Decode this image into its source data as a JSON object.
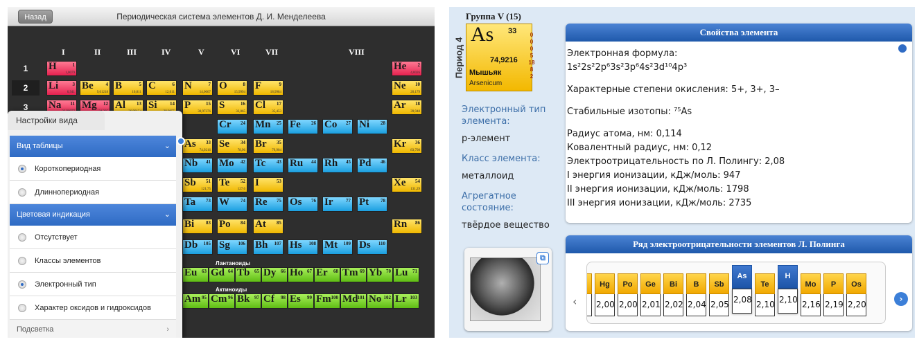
{
  "left_screen": {
    "back_label": "Назад",
    "title": "Периодическая система элементов Д. И. Менделеева",
    "groups": [
      "I",
      "II",
      "III",
      "IV",
      "V",
      "VI",
      "VII",
      "VIII"
    ],
    "periods": [
      "1",
      "2",
      "3"
    ],
    "elements": [
      {
        "sym": "H",
        "num": "1",
        "mass": "1,0079",
        "color": "red"
      },
      {
        "sym": "He",
        "num": "2",
        "mass": "4,0026",
        "color": "red"
      },
      {
        "sym": "Li",
        "num": "3",
        "mass": "6,941",
        "color": "red"
      },
      {
        "sym": "Be",
        "num": "4",
        "mass": "9,01218",
        "color": "yellow"
      },
      {
        "sym": "B",
        "num": "5",
        "mass": "10,811",
        "color": "yellow"
      },
      {
        "sym": "C",
        "num": "6",
        "mass": "12,011",
        "color": "yellow"
      },
      {
        "sym": "N",
        "num": "7",
        "mass": "14,0067",
        "color": "yellow"
      },
      {
        "sym": "O",
        "num": "8",
        "mass": "15,9994",
        "color": "yellow"
      },
      {
        "sym": "F",
        "num": "9",
        "mass": "18,9984",
        "color": "yellow"
      },
      {
        "sym": "Ne",
        "num": "10",
        "mass": "20,179",
        "color": "yellow"
      },
      {
        "sym": "Na",
        "num": "11",
        "mass": "22,98977",
        "color": "red"
      },
      {
        "sym": "Mg",
        "num": "12",
        "mass": "24,305",
        "color": "red"
      },
      {
        "sym": "Al",
        "num": "13",
        "mass": "26,98154",
        "color": "yellow"
      },
      {
        "sym": "Si",
        "num": "14",
        "mass": "28,0855",
        "color": "yellow"
      },
      {
        "sym": "P",
        "num": "15",
        "mass": "30,97376",
        "color": "yellow"
      },
      {
        "sym": "S",
        "num": "16",
        "mass": "32,065",
        "color": "yellow"
      },
      {
        "sym": "Cl",
        "num": "17",
        "mass": "35,453",
        "color": "yellow"
      },
      {
        "sym": "Ar",
        "num": "18",
        "mass": "39,948",
        "color": "yellow"
      },
      {
        "sym": "Sc",
        "num": "21",
        "mass": "",
        "color": "blue"
      },
      {
        "sym": "Ti",
        "num": "22",
        "mass": "",
        "color": "blue"
      },
      {
        "sym": "Cr",
        "num": "24",
        "mass": "",
        "color": "blue"
      },
      {
        "sym": "Mn",
        "num": "25",
        "mass": "",
        "color": "blue"
      },
      {
        "sym": "Fe",
        "num": "26",
        "mass": "",
        "color": "blue"
      },
      {
        "sym": "Co",
        "num": "27",
        "mass": "",
        "color": "blue"
      },
      {
        "sym": "Ni",
        "num": "28",
        "mass": "",
        "color": "blue"
      },
      {
        "sym": "As",
        "num": "33",
        "mass": "74,9216",
        "color": "yellow"
      },
      {
        "sym": "Se",
        "num": "34",
        "mass": "78,96",
        "color": "yellow"
      },
      {
        "sym": "Br",
        "num": "35",
        "mass": "79,904",
        "color": "yellow"
      },
      {
        "sym": "Kr",
        "num": "36",
        "mass": "83,798",
        "color": "yellow"
      },
      {
        "sym": "Nb",
        "num": "41",
        "mass": "",
        "color": "blue"
      },
      {
        "sym": "Mo",
        "num": "42",
        "mass": "",
        "color": "blue"
      },
      {
        "sym": "Tc",
        "num": "43",
        "mass": "",
        "color": "blue"
      },
      {
        "sym": "Ru",
        "num": "44",
        "mass": "",
        "color": "blue"
      },
      {
        "sym": "Rh",
        "num": "45",
        "mass": "",
        "color": "blue"
      },
      {
        "sym": "Pd",
        "num": "46",
        "mass": "",
        "color": "blue"
      },
      {
        "sym": "Sb",
        "num": "51",
        "mass": "121,75",
        "color": "yellow"
      },
      {
        "sym": "Te",
        "num": "52",
        "mass": "127,6",
        "color": "yellow"
      },
      {
        "sym": "I",
        "num": "53",
        "mass": "",
        "color": "yellow"
      },
      {
        "sym": "Xe",
        "num": "54",
        "mass": "131,29",
        "color": "yellow"
      },
      {
        "sym": "Ta",
        "num": "73",
        "mass": "",
        "color": "blue"
      },
      {
        "sym": "W",
        "num": "74",
        "mass": "",
        "color": "blue"
      },
      {
        "sym": "Re",
        "num": "75",
        "mass": "",
        "color": "blue"
      },
      {
        "sym": "Os",
        "num": "76",
        "mass": "",
        "color": "blue"
      },
      {
        "sym": "Ir",
        "num": "77",
        "mass": "",
        "color": "blue"
      },
      {
        "sym": "Pt",
        "num": "78",
        "mass": "",
        "color": "blue"
      },
      {
        "sym": "Bi",
        "num": "83",
        "mass": "",
        "color": "yellow"
      },
      {
        "sym": "Po",
        "num": "84",
        "mass": "",
        "color": "yellow"
      },
      {
        "sym": "At",
        "num": "85",
        "mass": "",
        "color": "yellow"
      },
      {
        "sym": "Rn",
        "num": "86",
        "mass": "",
        "color": "yellow"
      },
      {
        "sym": "Db",
        "num": "105",
        "mass": "",
        "color": "blue"
      },
      {
        "sym": "Sg",
        "num": "106",
        "mass": "",
        "color": "blue"
      },
      {
        "sym": "Bh",
        "num": "107",
        "mass": "",
        "color": "blue"
      },
      {
        "sym": "Hs",
        "num": "108",
        "mass": "",
        "color": "blue"
      },
      {
        "sym": "Mt",
        "num": "109",
        "mass": "",
        "color": "blue"
      },
      {
        "sym": "Ds",
        "num": "110",
        "mass": "",
        "color": "blue"
      },
      {
        "sym": "Eu",
        "num": "63",
        "mass": "",
        "color": "green"
      },
      {
        "sym": "Gd",
        "num": "64",
        "mass": "",
        "color": "green"
      },
      {
        "sym": "Tb",
        "num": "65",
        "mass": "",
        "color": "green"
      },
      {
        "sym": "Dy",
        "num": "66",
        "mass": "",
        "color": "green"
      },
      {
        "sym": "Ho",
        "num": "67",
        "mass": "",
        "color": "green"
      },
      {
        "sym": "Er",
        "num": "68",
        "mass": "",
        "color": "green"
      },
      {
        "sym": "Tm",
        "num": "69",
        "mass": "",
        "color": "green"
      },
      {
        "sym": "Yb",
        "num": "70",
        "mass": "",
        "color": "green"
      },
      {
        "sym": "Lu",
        "num": "71",
        "mass": "",
        "color": "green"
      },
      {
        "sym": "Am",
        "num": "95",
        "mass": "",
        "color": "green"
      },
      {
        "sym": "Cm",
        "num": "96",
        "mass": "",
        "color": "green"
      },
      {
        "sym": "Bk",
        "num": "97",
        "mass": "",
        "color": "green"
      },
      {
        "sym": "Cf",
        "num": "98",
        "mass": "",
        "color": "green"
      },
      {
        "sym": "Es",
        "num": "99",
        "mass": "",
        "color": "green"
      },
      {
        "sym": "Fm",
        "num": "100",
        "mass": "",
        "color": "green"
      },
      {
        "sym": "Md",
        "num": "101",
        "mass": "",
        "color": "green"
      },
      {
        "sym": "No",
        "num": "102",
        "mass": "",
        "color": "green"
      },
      {
        "sym": "Lr",
        "num": "103",
        "mass": "",
        "color": "green"
      }
    ],
    "lanthanides_label": "Лантаноиды",
    "actinides_label": "Актиноиды",
    "settings": {
      "title": "Настройки вида",
      "table_type_header": "Вид таблицы",
      "table_type_options": [
        {
          "label": "Короткопериодная",
          "selected": true
        },
        {
          "label": "Длиннопериодная",
          "selected": false
        }
      ],
      "color_header": "Цветовая индикация",
      "color_options": [
        {
          "label": "Отсутствует",
          "selected": false
        },
        {
          "label": "Классы элементов",
          "selected": false
        },
        {
          "label": "Электронный тип",
          "selected": true
        },
        {
          "label": "Характер оксидов и гидроксидов",
          "selected": false
        }
      ],
      "highlight_label": "Подсветка"
    }
  },
  "right_screen": {
    "group_title": "Группа V (15)",
    "period_label": "Период 4",
    "element": {
      "symbol": "As",
      "number": "33",
      "mass": "74,9216",
      "name": "Мышьяк",
      "latin": "Arsenicum",
      "shells": [
        "0",
        "0",
        "0",
        "5",
        "18",
        "8",
        "2"
      ]
    },
    "electron_type_label": "Электронный тип элемента:",
    "electron_type_value": "p-элемент",
    "class_label": "Класс элемента:",
    "class_value": "металлоид",
    "state_label": "Агрегатное состояние:",
    "state_value": "твёрдое вещество",
    "properties": {
      "title": "Свойства элемента",
      "formula_label": "Электронная формула:",
      "formula_value": "1s²2s²2p⁶3s²3p⁶4s²3d¹⁰4p³",
      "oxidation": "Характерные степени окисления: 5+, 3+, 3–",
      "isotopes": "Стабильные изотопы: ⁷⁵As",
      "lines": [
        "Радиус атома, нм: 0,114",
        "Ковалентный радиус, нм: 0,12",
        "Электроотрицательность по Л. Полингу: 2,08",
        "I энергия ионизации, кДж/моль: 947",
        "II энергия ионизации, кДж/моль: 1798",
        "III энергия ионизации, кДж/моль: 2735"
      ]
    },
    "electroneg": {
      "title": "Ряд электроотрицательности элементов Л. Полинга",
      "items": [
        {
          "sym": "",
          "val": "6",
          "highlight": false
        },
        {
          "sym": "Hg",
          "val": "2,00",
          "highlight": false
        },
        {
          "sym": "Po",
          "val": "2,00",
          "highlight": false
        },
        {
          "sym": "Ge",
          "val": "2,01",
          "highlight": false
        },
        {
          "sym": "Bi",
          "val": "2,02",
          "highlight": false
        },
        {
          "sym": "B",
          "val": "2,04",
          "highlight": false
        },
        {
          "sym": "Sb",
          "val": "2,05",
          "highlight": false
        },
        {
          "sym": "As",
          "val": "2,08",
          "highlight": true
        },
        {
          "sym": "Te",
          "val": "2,10",
          "highlight": false
        },
        {
          "sym": "H",
          "val": "2,10",
          "highlight": true
        },
        {
          "sym": "Mo",
          "val": "2,16",
          "highlight": false
        },
        {
          "sym": "P",
          "val": "2,19",
          "highlight": false
        },
        {
          "sym": "Os",
          "val": "2,20",
          "highlight": false
        }
      ]
    }
  }
}
